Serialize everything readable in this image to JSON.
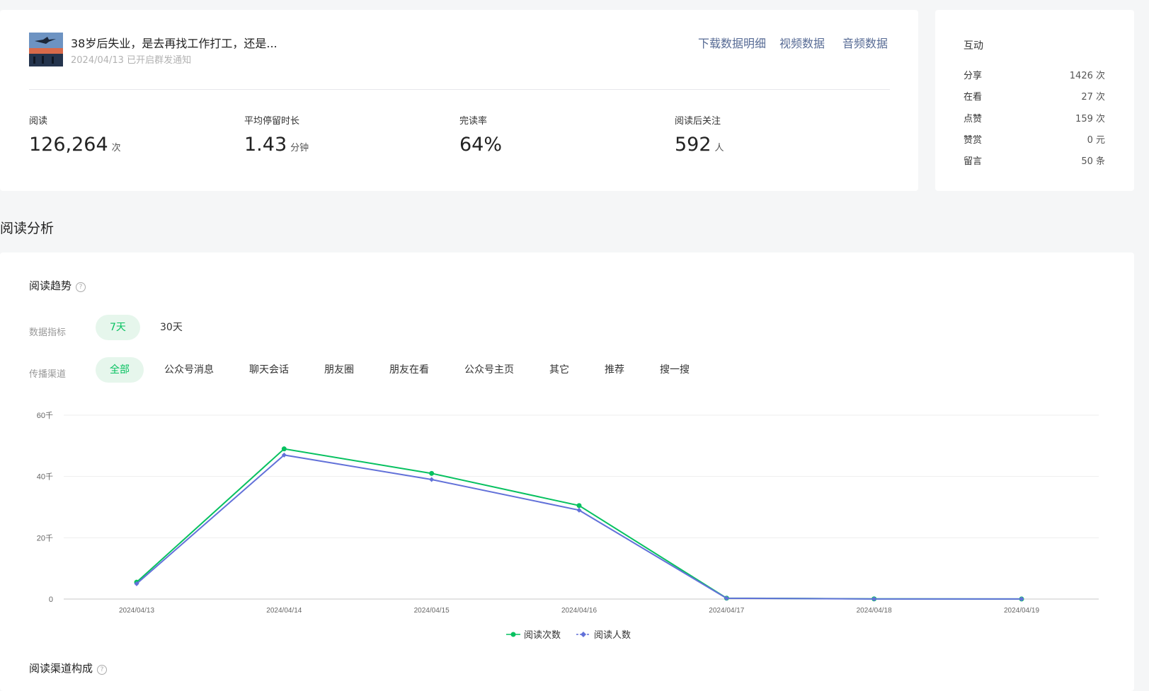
{
  "article": {
    "title": "38岁后失业，是去再找工作打工，还是...",
    "date": "2024/04/13",
    "notice": "已开启群发通知"
  },
  "top_links": [
    "下载数据明细",
    "视频数据",
    "音频数据"
  ],
  "metrics": [
    {
      "label": "阅读",
      "value": "126,264",
      "unit": "次"
    },
    {
      "label": "平均停留时长",
      "value": "1.43",
      "unit": "分钟"
    },
    {
      "label": "完读率",
      "value": "64%",
      "unit": ""
    },
    {
      "label": "阅读后关注",
      "value": "592",
      "unit": "人"
    }
  ],
  "interaction": {
    "title": "互动",
    "rows": [
      {
        "label": "分享",
        "value": "1426 次"
      },
      {
        "label": "在看",
        "value": "27 次"
      },
      {
        "label": "点赞",
        "value": "159 次"
      },
      {
        "label": "赞赏",
        "value": "0 元"
      },
      {
        "label": "留言",
        "value": "50 条"
      }
    ]
  },
  "section_title": "阅读分析",
  "trend": {
    "title": "阅读趋势",
    "metric_label": "数据指标",
    "ranges": [
      "7天",
      "30天"
    ],
    "active_range": "7天",
    "channel_label": "传播渠道",
    "channels": [
      "全部",
      "公众号消息",
      "聊天会话",
      "朋友圈",
      "朋友在看",
      "公众号主页",
      "其它",
      "推荐",
      "搜一搜"
    ],
    "active_channel": "全部"
  },
  "chart_data": {
    "type": "line",
    "x": [
      "2024/04/13",
      "2024/04/14",
      "2024/04/15",
      "2024/04/16",
      "2024/04/17",
      "2024/04/18",
      "2024/04/19"
    ],
    "series": [
      {
        "name": "阅读次数",
        "color": "#07c160",
        "marker": "circle",
        "values": [
          5500,
          49000,
          41000,
          30500,
          300,
          50,
          20
        ]
      },
      {
        "name": "阅读人数",
        "color": "#6271d9",
        "marker": "diamond",
        "values": [
          5000,
          47000,
          39000,
          29000,
          250,
          40,
          15
        ]
      }
    ],
    "ylim": [
      0,
      60000
    ],
    "yticks": [
      {
        "v": 0,
        "label": "0"
      },
      {
        "v": 20000,
        "label": "20千"
      },
      {
        "v": 40000,
        "label": "40千"
      },
      {
        "v": 60000,
        "label": "60千"
      }
    ],
    "grid": true,
    "legend": "bottom-center"
  },
  "channel_composition": {
    "title": "阅读渠道构成"
  }
}
